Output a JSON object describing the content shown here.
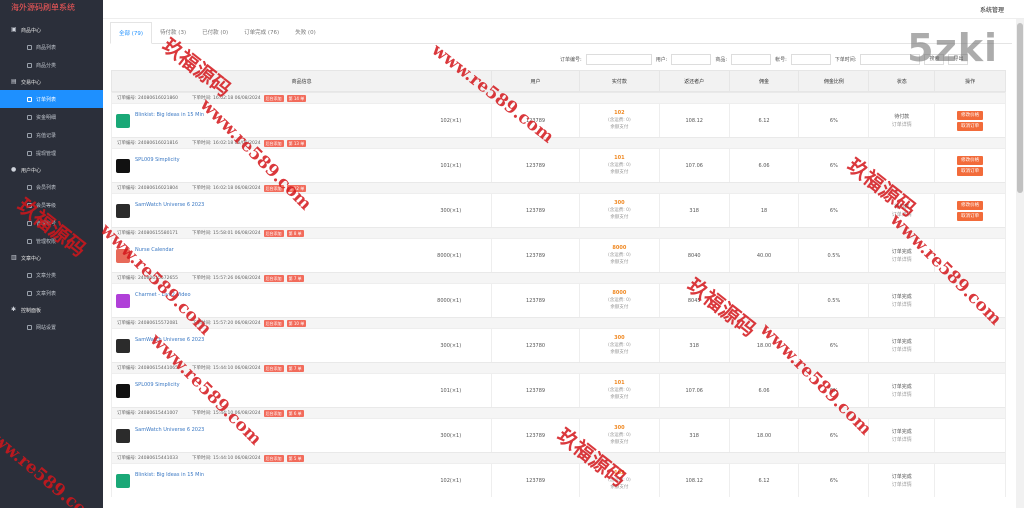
{
  "app": {
    "title": "海外源码刷单系统",
    "system_label": "系统管理"
  },
  "sidebar": {
    "groups": [
      {
        "label": "商品中心",
        "icon": "cube-icon",
        "items": [
          {
            "label": "商品列表"
          },
          {
            "label": "商品分类"
          }
        ]
      },
      {
        "label": "交易中心",
        "icon": "chart-icon",
        "items": [
          {
            "label": "订单列表",
            "active": true
          },
          {
            "label": "资金明细"
          },
          {
            "label": "充值记录"
          },
          {
            "label": "提现管理"
          }
        ]
      },
      {
        "label": "用户中心",
        "icon": "user-icon",
        "items": [
          {
            "label": "会员列表"
          },
          {
            "label": "会员等级"
          },
          {
            "label": "管理帐号"
          },
          {
            "label": "管理权限"
          }
        ]
      },
      {
        "label": "文章中心",
        "icon": "doc-icon",
        "items": [
          {
            "label": "文章分类"
          },
          {
            "label": "文章列表"
          }
        ]
      },
      {
        "label": "控制面板",
        "icon": "gear-icon",
        "items": [
          {
            "label": "网站设置"
          }
        ]
      }
    ]
  },
  "tabs": [
    {
      "label": "全部 (79)",
      "active": true
    },
    {
      "label": "待付款 (3)"
    },
    {
      "label": "已付款 (0)"
    },
    {
      "label": "订单完成 (76)"
    },
    {
      "label": "失败 (0)"
    }
  ],
  "filters": {
    "labels": [
      "订单编号:",
      "用户:",
      "商品:",
      "帐号:",
      "下单时间:"
    ],
    "search_btn": "搜索",
    "export_btn": "导出"
  },
  "table": {
    "headers": [
      "商品信息",
      "用户",
      "实付款",
      "返还者户",
      "佣金",
      "佣金比例",
      "状态",
      "操作"
    ],
    "order_no_label": "订单编号:",
    "time_label": "下单时间:",
    "pay_lines": [
      "(含运费: 0)",
      "余额支付"
    ],
    "op_labels": [
      "修改价格",
      "取消订单"
    ],
    "tag_label": "后台添加"
  },
  "orders": [
    {
      "no": "24080616021860",
      "time": "16:02:18 06/08/2024",
      "stage": "第 14 单",
      "product": "Blinkist: Big Ideas in 15 Min",
      "qty": "102(×1)",
      "user": "123789",
      "pay": "102",
      "ret": "108.12",
      "commission": "6.12",
      "rate": "6%",
      "status": [
        "待付款",
        "订单详情"
      ],
      "ops": true,
      "thumb": "#1aa877"
    },
    {
      "no": "24080616021816",
      "time": "16:02:18 06/08/2024",
      "stage": "第 13 单",
      "product": "SPL009 Simplicity",
      "qty": "101(×1)",
      "user": "123789",
      "pay": "101",
      "ret": "107.06",
      "commission": "6.06",
      "rate": "6%",
      "status": [],
      "ops": true,
      "thumb": "#111111"
    },
    {
      "no": "24080616021804",
      "time": "16:02:18 06/08/2024",
      "stage": "第 12 单",
      "product": "SamWatch Universe 6 2023",
      "qty": "300(×1)",
      "user": "123789",
      "pay": "300",
      "ret": "318",
      "commission": "18",
      "rate": "6%",
      "status": [
        "待付款",
        "订单详情"
      ],
      "ops": true,
      "thumb": "#2b2b2b"
    },
    {
      "no": "24080615580171",
      "time": "15:58:01 06/08/2024",
      "stage": "第 8 单",
      "product": "Nurse Calendar",
      "qty": "8000(×1)",
      "user": "123789",
      "pay": "8000",
      "ret": "8040",
      "commission": "40.00",
      "rate": "0.5%",
      "status": [
        "订单完成",
        "订单详情"
      ],
      "ops": false,
      "thumb": "#e86a5a"
    },
    {
      "no": "24080615572655",
      "time": "15:57:26 06/08/2024",
      "stage": "第 7 单",
      "product": "Charmet - Live2 Video",
      "qty": "8000(×1)",
      "user": "123789",
      "pay": "8000",
      "ret": "8045",
      "commission": "",
      "rate": "0.5%",
      "status": [
        "订单完成",
        "订单详情"
      ],
      "ops": false,
      "thumb": "#b040d8"
    },
    {
      "no": "24080615572081",
      "time": "15:57:20 06/08/2024",
      "stage": "第 10 单",
      "product": "SamWatch Universe 6 2023",
      "qty": "300(×1)",
      "user": "123780",
      "pay": "300",
      "ret": "318",
      "commission": "18.00",
      "rate": "6%",
      "status": [
        "订单完成",
        "订单详情"
      ],
      "ops": false,
      "thumb": "#2b2b2b"
    },
    {
      "no": "24080615441065",
      "time": "15:44:10 06/08/2024",
      "stage": "第 7 单",
      "product": "SPL009 Simplicity",
      "qty": "101(×1)",
      "user": "123789",
      "pay": "101",
      "ret": "107.06",
      "commission": "6.06",
      "rate": "6%",
      "status": [
        "订单完成",
        "订单详情"
      ],
      "ops": false,
      "thumb": "#111111"
    },
    {
      "no": "24080615441007",
      "time": "15:44:10 06/08/2024",
      "stage": "第 6 单",
      "product": "SamWatch Universe 6 2023",
      "qty": "300(×1)",
      "user": "123789",
      "pay": "300",
      "ret": "318",
      "commission": "18.00",
      "rate": "6%",
      "status": [
        "订单完成",
        "订单详情"
      ],
      "ops": false,
      "thumb": "#2b2b2b"
    },
    {
      "no": "24080615441033",
      "time": "15:44:10 06/08/2024",
      "stage": "第 5 单",
      "product": "Blinkist: Big Ideas in 15 Min",
      "qty": "102(×1)",
      "user": "123789",
      "pay": "102",
      "ret": "108.12",
      "commission": "6.12",
      "rate": "6%",
      "status": [
        "订单完成",
        "订单详情"
      ],
      "ops": false,
      "thumb": "#1aa877"
    }
  ],
  "watermark": {
    "text_a": "玖福源码",
    "text_b": "www.re589.com",
    "brand": "5zki"
  }
}
